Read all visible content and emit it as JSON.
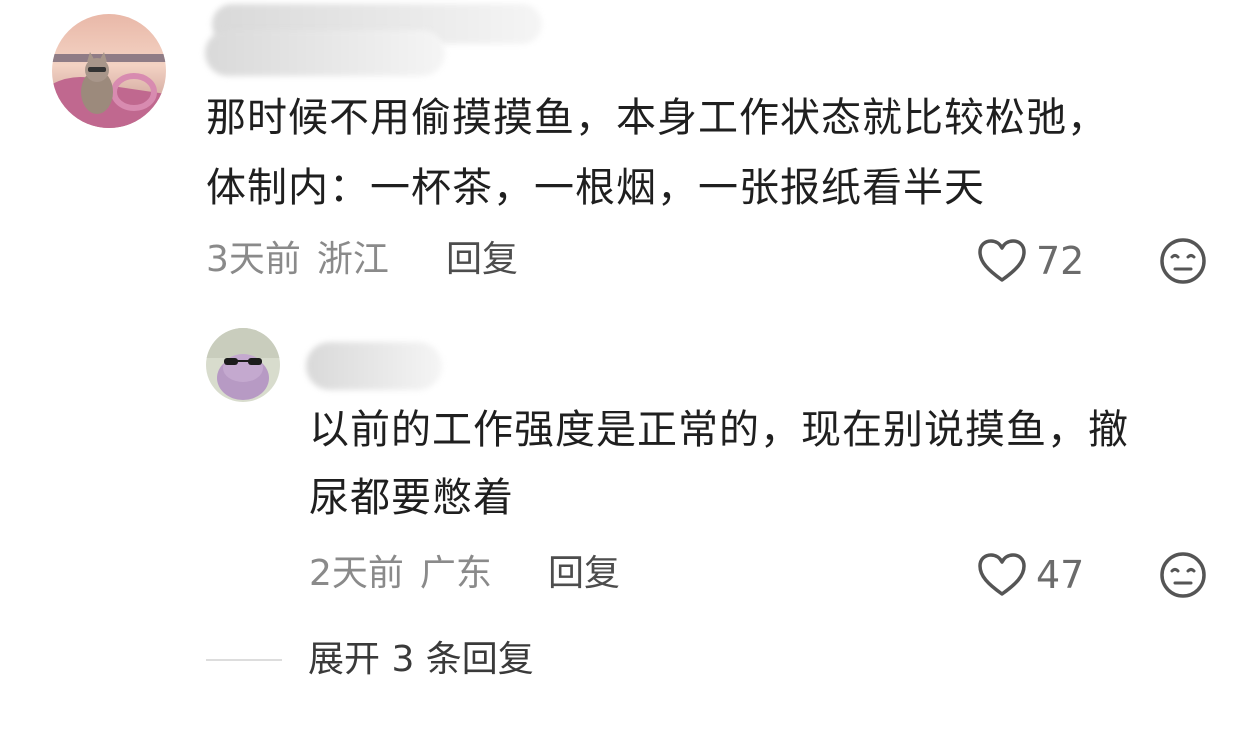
{
  "comment": {
    "text_line1": "那时候不用偷摸摸鱼，本身工作状态就比较松弛，",
    "text_line2": "体制内：一杯茶，一根烟，一张报纸看半天",
    "time": "3天前",
    "location": "浙江",
    "reply_label": "回复",
    "likes": "72"
  },
  "reply": {
    "text_line1": "以前的工作强度是正常的，现在别说摸鱼，撤",
    "text_line2": "尿都要憋着",
    "time": "2天前",
    "location": "广东",
    "reply_label": "回复",
    "likes": "47"
  },
  "expand": {
    "label": "展开 3 条回复"
  },
  "icons": {
    "like": "heart-outline-icon",
    "dislike": "neutral-face-icon"
  },
  "colors": {
    "text": "#1f1f1f",
    "meta": "#8a8a8a",
    "icon": "#555555"
  }
}
